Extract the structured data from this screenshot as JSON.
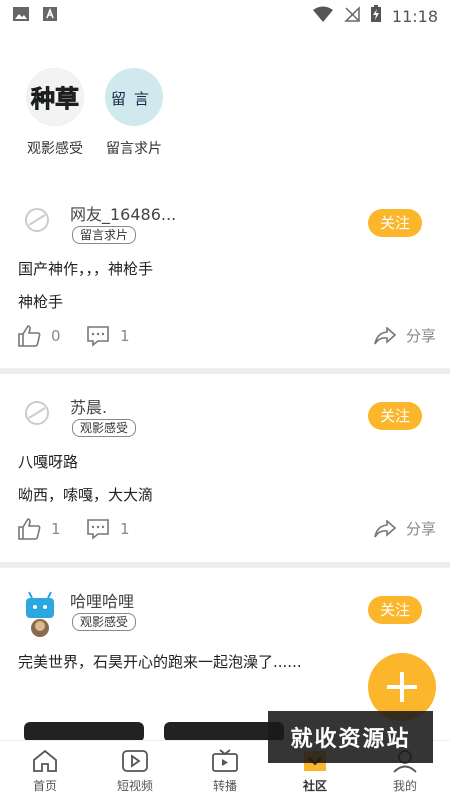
{
  "status_bar": {
    "time": "11:18"
  },
  "categories": [
    {
      "label": "观影感受",
      "badge_text": "种草"
    },
    {
      "label": "留言求片",
      "badge_text": "留言"
    }
  ],
  "posts": [
    {
      "username": "网友_16486...",
      "tag": "留言求片",
      "follow_label": "关注",
      "lines": [
        "国产神作，，，神枪手",
        "神枪手"
      ],
      "likes": "0",
      "comments": "1",
      "share_label": "分享"
    },
    {
      "username": "苏晨.",
      "tag": "观影感受",
      "follow_label": "关注",
      "lines": [
        "八嘎呀路",
        "呦西，嗦嘎，大大滴"
      ],
      "likes": "1",
      "comments": "1",
      "share_label": "分享"
    },
    {
      "username": "哈哩哈哩",
      "tag": "观影感受",
      "follow_label": "关注",
      "lines": [
        "完美世界，石昊开心的跑来一起泡澡了......"
      ]
    }
  ],
  "watermark": "就收资源站",
  "bottom_nav": [
    {
      "label": "首页",
      "icon": "home-icon"
    },
    {
      "label": "短视频",
      "icon": "video-icon"
    },
    {
      "label": "转播",
      "icon": "tv-icon"
    },
    {
      "label": "社区",
      "icon": "community-icon",
      "active": true
    },
    {
      "label": "我的",
      "icon": "profile-icon"
    }
  ],
  "colors": {
    "accent": "#fbb62b",
    "divider": "#eeeeee",
    "text": "#222222"
  }
}
